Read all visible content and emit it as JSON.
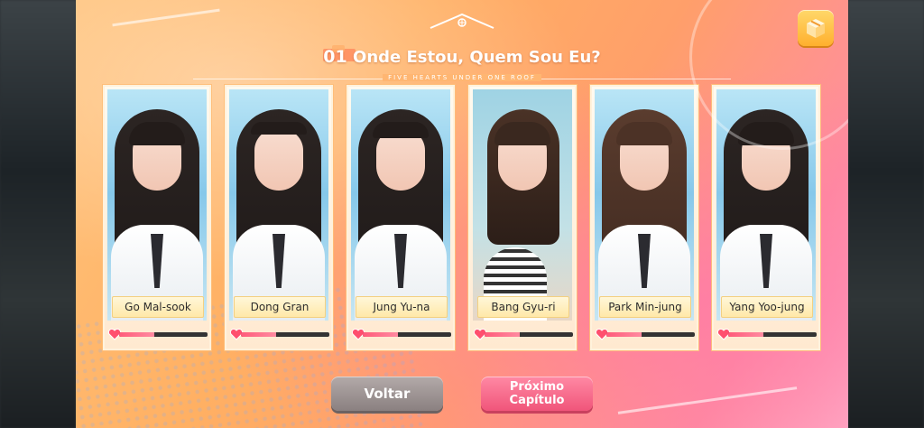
{
  "chapter": {
    "number": "01",
    "title": "Onde Estou, Quem Sou Eu?",
    "subtitle": "FIVE HEARTS UNDER ONE ROOF"
  },
  "icons": {
    "top_right": "gift-box-icon",
    "title_roof": "house-roof-icon",
    "affection": "heart-icon"
  },
  "characters": [
    {
      "name": "Go Mal-sook",
      "affection": 0.4
    },
    {
      "name": "Dong Gran",
      "affection": 0.4
    },
    {
      "name": "Jung Yu-na",
      "affection": 0.4
    },
    {
      "name": "Bang Gyu-ri",
      "affection": 0.4
    },
    {
      "name": "Park Min-jung",
      "affection": 0.4
    },
    {
      "name": "Yang Yoo-jung",
      "affection": 0.4
    }
  ],
  "buttons": {
    "back_label": "Voltar",
    "next_line1": "Próximo",
    "next_line2": "Capítulo"
  },
  "colors": {
    "accent_pink": "#f0557a",
    "gold": "#ffb02e",
    "heart": "#ff4f6e"
  }
}
